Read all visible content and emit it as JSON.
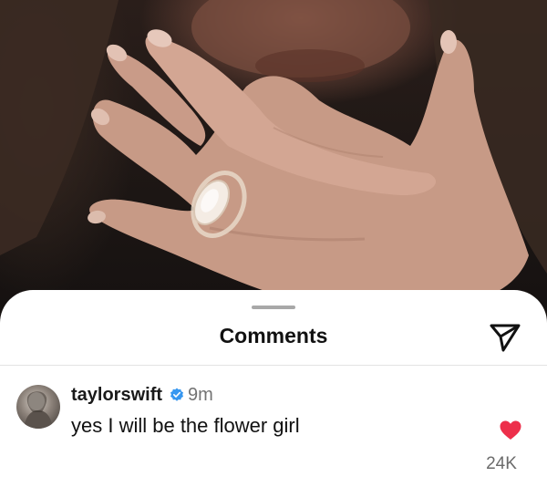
{
  "sheet": {
    "title": "Comments",
    "share_icon": "send-icon"
  },
  "comment": {
    "username": "taylorswift",
    "verified": true,
    "time": "9m",
    "text": "yes I will be the flower girl",
    "likes": "24K",
    "liked": true,
    "like_color": "#ed2f4b",
    "verified_color": "#3797f0"
  }
}
